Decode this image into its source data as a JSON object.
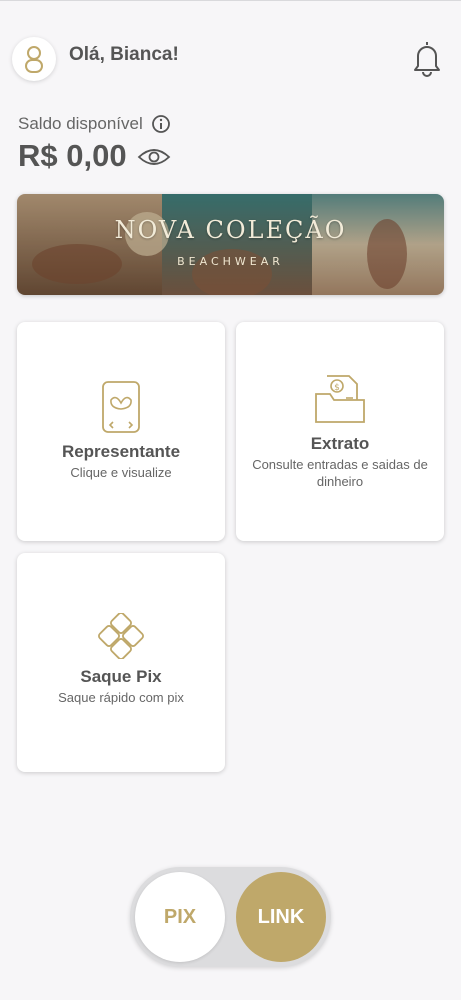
{
  "header": {
    "greeting": "Olá, Bianca!"
  },
  "balance": {
    "label": "Saldo disponível",
    "value": "R$ 0,00"
  },
  "banner": {
    "title": "NOVA COLEÇÃO",
    "subtitle": "BEACHWEAR"
  },
  "cards": [
    {
      "title": "Representante",
      "subtitle": "Clique e visualize",
      "icon": "phone-bra-icon"
    },
    {
      "title": "Extrato",
      "subtitle": "Consulte entradas e saidas de dinheiro",
      "icon": "folder-document-icon"
    },
    {
      "title": "Saque Pix",
      "subtitle": "Saque rápido com pix",
      "icon": "pix-icon"
    }
  ],
  "toggle": {
    "pix_label": "PIX",
    "link_label": "LINK",
    "active": "LINK"
  },
  "colors": {
    "accent": "#bfa86a",
    "background": "#f7f6f8",
    "text": "#555555"
  }
}
